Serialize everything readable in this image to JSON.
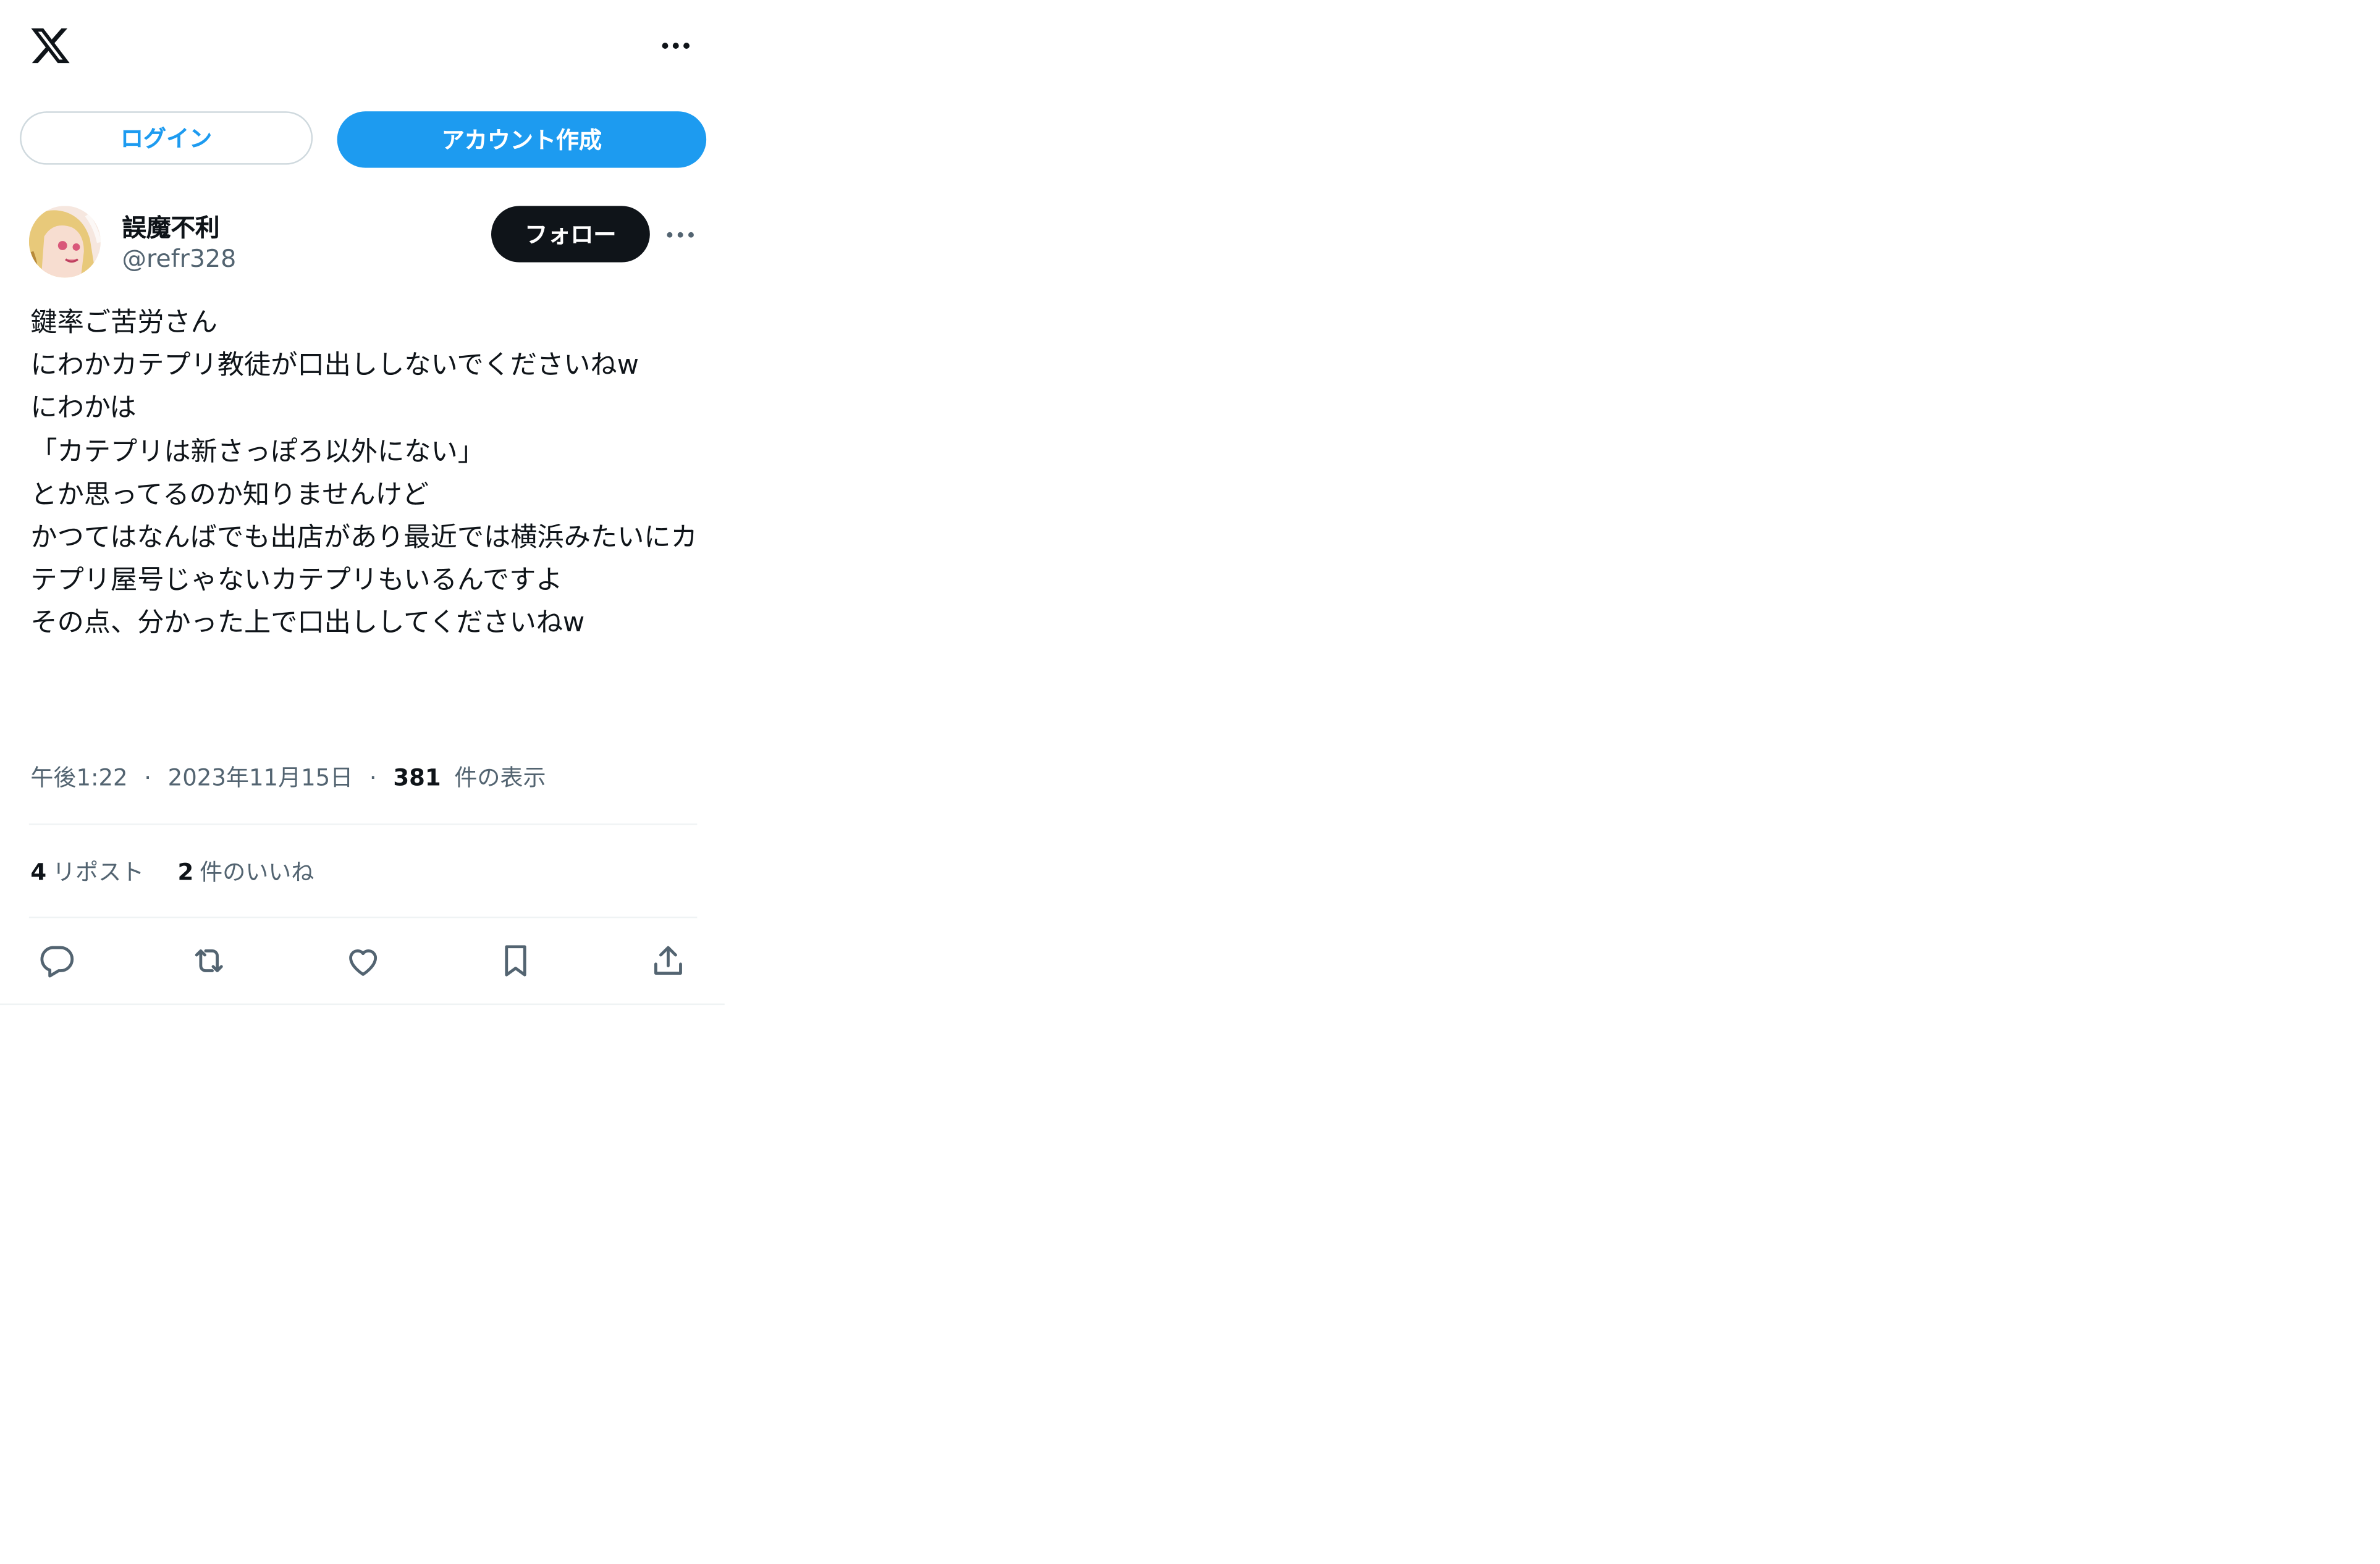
{
  "header": {
    "logo_icon": "x-logo-icon",
    "more_icon": "more-horizontal-icon"
  },
  "auth": {
    "login_label": "ログイン",
    "signup_label": "アカウント作成",
    "signup_color": "#1d9bf0"
  },
  "tweet": {
    "display_name": "誤魔不利",
    "handle": "@refr328",
    "follow_label": "フォロー",
    "text": "鍵率ご苦労さん\nにわかカテプリ教徒が口出ししないでくださいねw\nにわかは\n「カテプリは新さっぽろ以外にない」\nとか思ってるのか知りませんけど\nかつてはなんばでも出店があり最近では横浜みたいにカテプリ屋号じゃないカテプリもいるんですよ\nその点、分かった上で口出ししてくださいねw",
    "time": "午後1:22",
    "date": "2023年11月15日",
    "separator": "·",
    "views_count": "381",
    "views_label": "件の表示",
    "reposts_count": "4",
    "reposts_label": "リポスト",
    "likes_count": "2",
    "likes_label": "件のいいね"
  },
  "actions": [
    {
      "icon": "reply-icon"
    },
    {
      "icon": "retweet-icon"
    },
    {
      "icon": "like-icon"
    },
    {
      "icon": "bookmark-icon"
    },
    {
      "icon": "share-icon"
    }
  ],
  "colors": {
    "text_primary": "#0f1419",
    "text_secondary": "#536471",
    "border": "#eff3f4",
    "follow_bg": "#0f1419"
  }
}
